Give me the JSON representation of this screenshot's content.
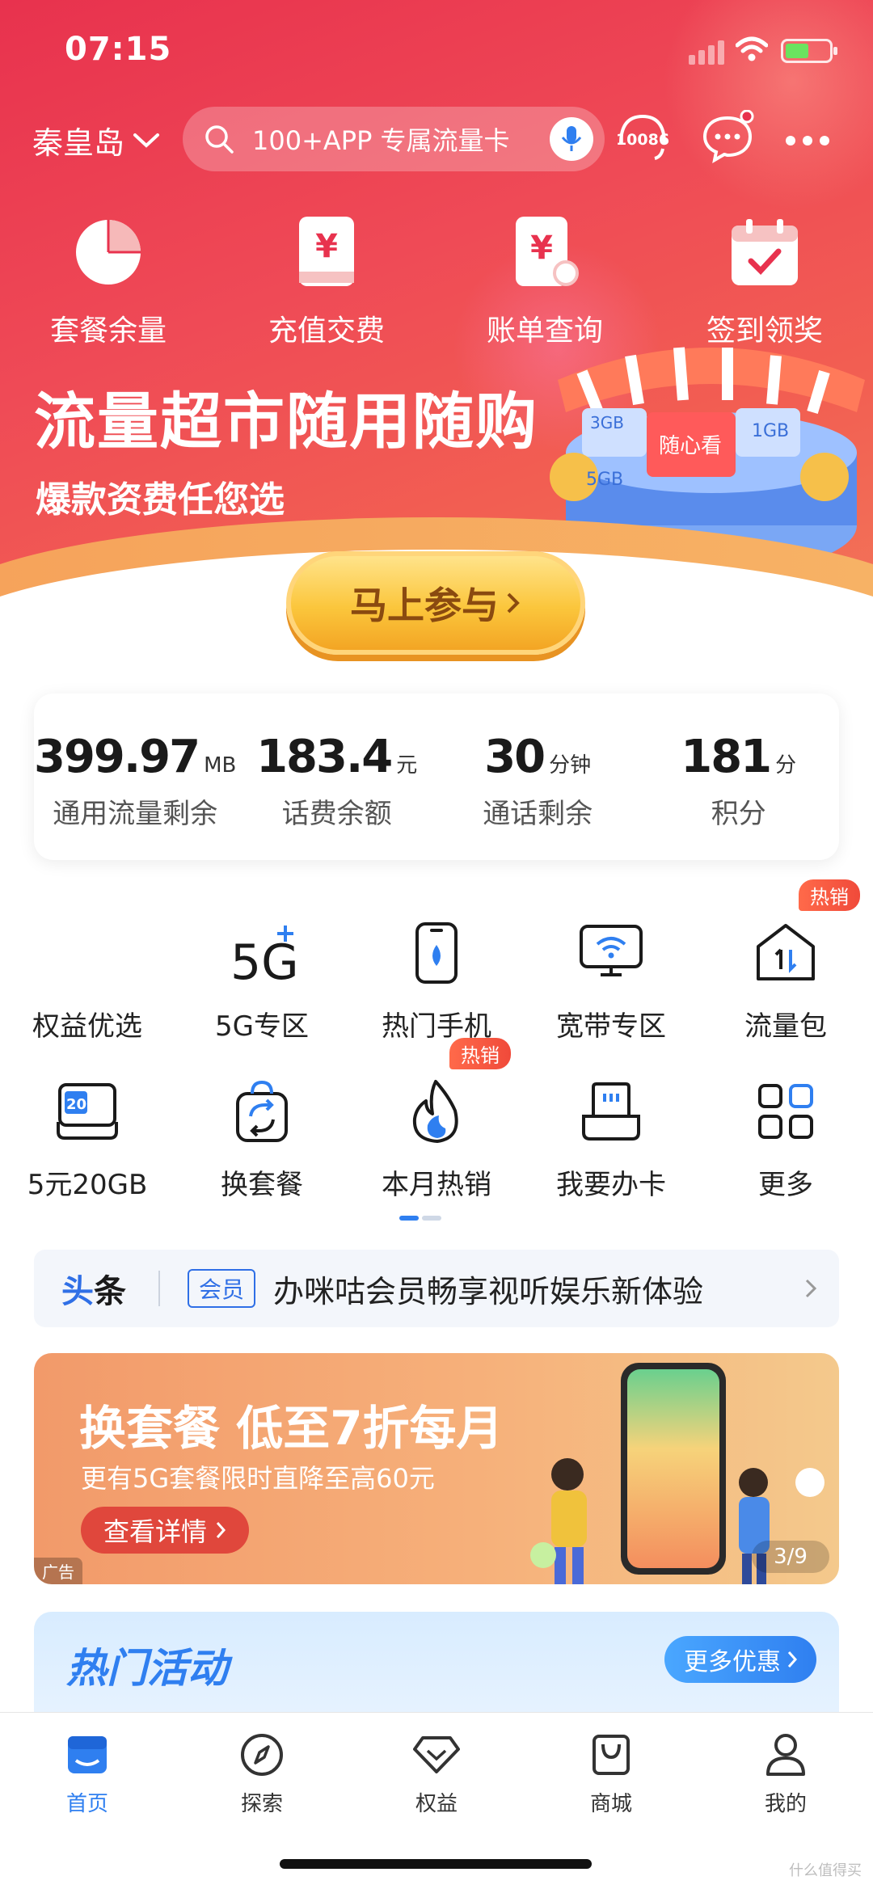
{
  "status": {
    "time": "07:15"
  },
  "header": {
    "city": "秦皇岛",
    "search_placeholder": "100+APP 专属流量卡",
    "hotline": "10086"
  },
  "quick_entries": [
    {
      "label": "套餐余量",
      "icon": "pie-chart-icon"
    },
    {
      "label": "充值交费",
      "icon": "yuan-card-icon"
    },
    {
      "label": "账单查询",
      "icon": "yuan-bill-icon"
    },
    {
      "label": "签到领奖",
      "icon": "calendar-check-icon"
    }
  ],
  "banner": {
    "title": "流量超市随用随购",
    "subtitle": "爆款资费任您选",
    "cta": "马上参与",
    "art_tags": [
      "3GB",
      "5GB",
      "随心看",
      "1GB"
    ]
  },
  "stats": [
    {
      "value": "399.97",
      "unit": "MB",
      "label": "通用流量剩余"
    },
    {
      "value": "183.4",
      "unit": "元",
      "label": "话费余额"
    },
    {
      "value": "30",
      "unit": "分钟",
      "label": "通话剩余"
    },
    {
      "value": "181",
      "unit": "分",
      "label": "积分"
    }
  ],
  "grid": [
    {
      "label": "权益优选",
      "icon": "benefits-icon"
    },
    {
      "label": "5G专区",
      "icon": "5g-plus-icon",
      "icon_text": "5G"
    },
    {
      "label": "热门手机",
      "icon": "phone-icon"
    },
    {
      "label": "宽带专区",
      "icon": "monitor-wifi-icon"
    },
    {
      "label": "流量包",
      "icon": "data-pack-icon",
      "badge": "热销"
    },
    {
      "label": "5元20GB",
      "icon": "20gb-icon",
      "icon_text": "20GB"
    },
    {
      "label": "换套餐",
      "icon": "switch-plan-icon"
    },
    {
      "label": "本月热销",
      "icon": "flame-icon",
      "badge": "热销"
    },
    {
      "label": "我要办卡",
      "icon": "sim-card-icon"
    },
    {
      "label": "更多",
      "icon": "more-grid-icon"
    }
  ],
  "headline": {
    "tag_a": "头",
    "tag_b": "条",
    "badge": "会员",
    "text": "办咪咕会员畅享视听娱乐新体验"
  },
  "ad": {
    "title": "换套餐 低至7折每月",
    "subtitle": "更有5G套餐限时直降至高60元",
    "button": "查看详情",
    "tag": "广告",
    "page": "3/9"
  },
  "activity": {
    "title": "热门活动",
    "more": "更多优惠"
  },
  "tabbar": [
    {
      "label": "首页",
      "icon": "home-icon",
      "active": true
    },
    {
      "label": "探索",
      "icon": "compass-icon"
    },
    {
      "label": "权益",
      "icon": "diamond-icon"
    },
    {
      "label": "商城",
      "icon": "shopping-bag-icon"
    },
    {
      "label": "我的",
      "icon": "user-icon"
    }
  ],
  "watermark": "什么值得买",
  "colors": {
    "brand_red": "#e8324e",
    "accent_blue": "#2f7ff0",
    "hot_orange": "#f04a3a"
  }
}
